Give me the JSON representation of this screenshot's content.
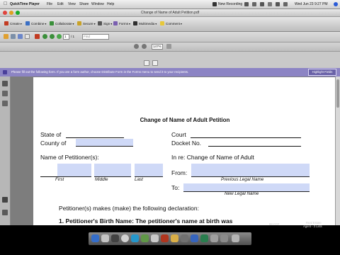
{
  "menubar": {
    "app_name": "QuickTime Player",
    "items": [
      "File",
      "Edit",
      "View",
      "Share",
      "Window",
      "Help"
    ],
    "status_recording": "New Recording",
    "clock": "Wed Jun 23  9:27 PM"
  },
  "window": {
    "title": "Change of Name of Adult Petition.pdf"
  },
  "tasks": {
    "create": "Create",
    "combine": "Combine",
    "collaborate": "Collaborate",
    "secure": "Secure",
    "sign": "Sign",
    "forms": "Forms",
    "multimedia": "Multimedia",
    "comment": "Comment"
  },
  "nav": {
    "page_number": "1",
    "page_count": "/ 1",
    "find_placeholder": "Find"
  },
  "view": {
    "zoom": "147%"
  },
  "formbar": {
    "message": "Please fill out the following form. If you are a form author, choose Distribute Form in the Forms menu to send it to your recipients.",
    "highlight_button": "Highlight Fields"
  },
  "document": {
    "title": "Change of Name of Adult Petition",
    "state_label": "State of",
    "county_label": "County of",
    "court_label": "Court",
    "docket_label": "Docket No.",
    "petitioner_label": "Name of Petitioner(s):",
    "first_label": "First",
    "middle_label": "Middle",
    "last_label": "Last",
    "in_re_label": "In re:  Change of Name of Adult",
    "from_label": "From:",
    "previous_name_label": "Previous Legal Name",
    "to_label": "To:",
    "new_name_label": "New Legal Name",
    "declaration_text": "Petitioner(s) makes (make) the following declaration:",
    "clipped_line": "1. Petitioner's Birth Name:     The petitioner's name at birth was"
  },
  "dock": {
    "battery": "68.CCF",
    "user_line1": "Real Estate",
    "user_line2": "Agent - 3 Lists"
  },
  "colors": {
    "form_bar": "#8c84c4",
    "form_field": "#cfd9f7",
    "doc_background": "#7d7d7d"
  }
}
